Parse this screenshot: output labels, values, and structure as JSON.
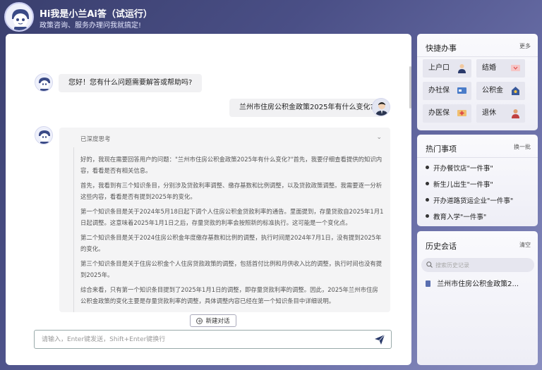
{
  "header": {
    "title": "Hi我是小兰Ai答（试运行）",
    "subtitle": "政策咨询、服务办理问我就搞定!"
  },
  "chat": {
    "bot_greeting": "您好！您有什么问题需要解答或帮助吗?",
    "user_question": "兰州市住房公积金政策2025年有什么变化?",
    "thinking": {
      "header": "已深度思考",
      "paragraphs": [
        "好的，我现在需要回答用户的问题：\"兰州市住房公积金政策2025年有什么变化?\"首先，我要仔细查看提供的知识内容，看看是否有相关信息。",
        "首先，我看到有三个知识条目，分别涉及贷款利率调整、缴存基数和比例调整，以及贷款政策调整。我需要逐一分析这些内容，看看是否有提到2025年的变化。",
        "第一个知识条目是关于2024年5月18日起下调个人住房公积金贷款利率的通告。里面提到，存量贷款自2025年1月1日起调整。这意味着2025年1月1日之后，存量贷款的利率会按照新的标准执行。这可能是一个变化点。",
        "第二个知识条目是关于2024住房公积金年度缴存基数和比例的调整，执行时间是2024年7月1日，没有提到2025年的变化。",
        "第三个知识条目是关于住房公积金个人住房贷款政策的调整，包括首付比例和月供收入比的调整，执行时间也没有提到2025年。",
        "综合来看，只有第一个知识条目提到了2025年1月1日的调整，即存量贷款利率的调整。因此，2025年兰州市住房公积金政策的变化主要是存量贷款利率的调整，具体调整内容已经在第一个知识条目中详细说明。"
      ]
    },
    "new_chat_label": "新建对话",
    "input_placeholder": "请输入，Enter键发送，Shift+Enter键换行"
  },
  "quick": {
    "title": "快捷办事",
    "more": "更多",
    "items": [
      {
        "label": "上户口",
        "icon": "person-icon"
      },
      {
        "label": "结婚",
        "icon": "marriage-certificate-icon"
      },
      {
        "label": "办社保",
        "icon": "social-security-card-icon"
      },
      {
        "label": "公积金",
        "icon": "fund-icon"
      },
      {
        "label": "办医保",
        "icon": "medical-card-icon"
      },
      {
        "label": "退休",
        "icon": "retirement-icon"
      }
    ]
  },
  "hot": {
    "title": "热门事项",
    "more": "换一批",
    "items": [
      "开办餐饮店\"一件事\"",
      "新生儿出生\"一件事\"",
      "开办道路货运企业\"一件事\"",
      "教育入学\"一件事\""
    ]
  },
  "history": {
    "title": "历史会话",
    "clear": "清空",
    "search_placeholder": "搜索历史记录",
    "items": [
      "兰州市住房公积金政策2..."
    ]
  },
  "colors": {
    "accent": "#3d4a8c",
    "panel_bg": "#f4f4f8",
    "bubble": "#f1f1f3"
  }
}
